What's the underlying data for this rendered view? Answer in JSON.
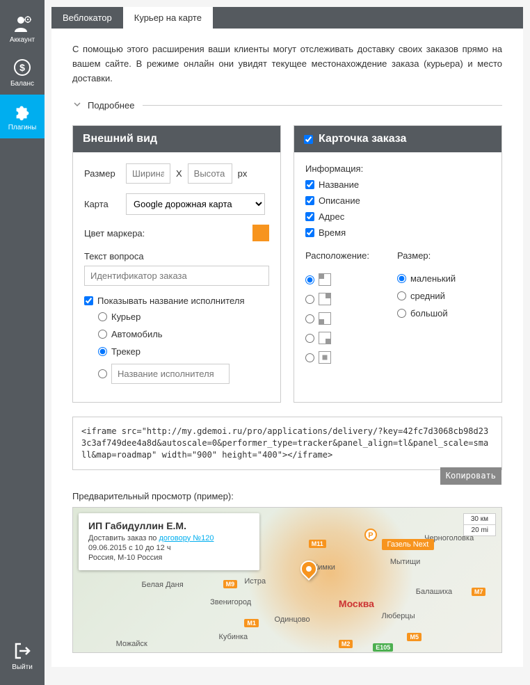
{
  "sidebar": {
    "account": "Аккаунт",
    "balance": "Баланс",
    "plugins": "Плагины",
    "exit": "Выйти"
  },
  "tabs": {
    "weblocator": "Веблокатор",
    "courier": "Курьер на карте"
  },
  "intro": "С помощью этого расширения ваши клиенты могут отслеживать доставку своих заказов прямо на вашем сайте. В режиме онлайн они увидят текущее местонахождение заказа (курьера) и место доставки.",
  "expand": "Подробнее",
  "appearance": {
    "title": "Внешний вид",
    "size_label": "Размер",
    "width_ph": "Ширина",
    "height_ph": "Высота",
    "px": "px",
    "x": "X",
    "map_label": "Карта",
    "map_value": "Google дорожная карта",
    "marker_label": "Цвет маркера:",
    "marker_color": "#f7941e",
    "question_label": "Текст вопроса",
    "question_ph": "Идентификатор заказа",
    "show_performer": "Показывать название исполнителя",
    "options": {
      "courier": "Курьер",
      "car": "Автомобиль",
      "tracker": "Трекер",
      "custom_ph": "Название исполнителя"
    }
  },
  "card": {
    "title": "Карточка заказа",
    "info_label": "Информация:",
    "info": {
      "name": "Название",
      "desc": "Описание",
      "address": "Адрес",
      "time": "Время"
    },
    "position_label": "Расположение:",
    "size_label": "Размер:",
    "sizes": {
      "small": "маленький",
      "medium": "средний",
      "large": "большой"
    }
  },
  "code": "<iframe src=\"http://my.gdemoi.ru/pro/applications/delivery/?key=42fc7d3068cb98d233c3af749dee4a8d&autoscale=0&performer_type=tracker&panel_align=tl&panel_scale=small&map=roadmap\" width=\"900\" height=\"400\"></iframe>",
  "copy": "Копировать",
  "preview_title": "Предварительный просмотр (пример):",
  "preview": {
    "card_title": "ИП Габидуллин Е.М.",
    "card_desc_prefix": "Доставить заказ по ",
    "card_desc_link": "договору №120",
    "card_time": "09.06.2015 с 10 до 12 ч",
    "card_addr": "Россия, М-10 Россия",
    "scale_km": "30 км",
    "scale_mi": "20 mi",
    "vehicle": "Газель Next",
    "parking": "P",
    "cities": {
      "moscow": "Москва",
      "khimki": "Химки",
      "mytischi": "Мытищи",
      "lyubertsy": "Люберцы",
      "odintsovo": "Одинцово",
      "balashikha": "Балашиха",
      "zvenigorod": "Звенигород",
      "istra": "Истра",
      "belaya": "Белая Даня",
      "mozhaysk": "Можайск",
      "kubinka": "Кубинка",
      "chernogolovka": "Черноголовка"
    },
    "roads": {
      "m11": "М11",
      "m9": "M9",
      "m1": "M1",
      "m2": "M2",
      "m5": "M5",
      "m7": "M7",
      "e105": "E105"
    }
  }
}
